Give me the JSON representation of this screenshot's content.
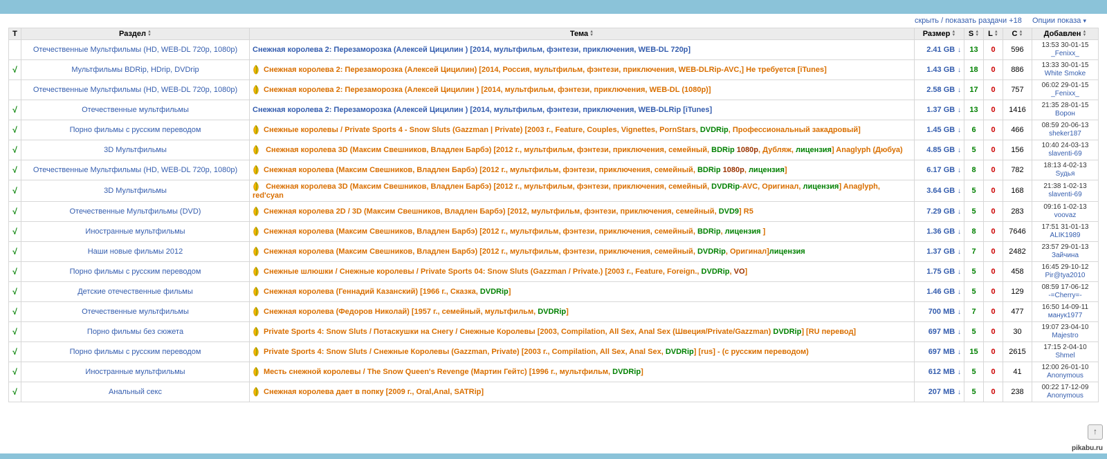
{
  "top_links": {
    "hide_show": "скрыть / показать раздачи +18",
    "display_options": "Опции показа"
  },
  "headers": {
    "t": "Т",
    "section": "Раздел",
    "topic": "Тема",
    "size": "Размер",
    "s": "S",
    "l": "L",
    "c": "C",
    "added": "Добавлен"
  },
  "col_widths": {
    "chk": 18,
    "cat": 330,
    "topic": 0,
    "size": 72,
    "s": 28,
    "l": 28,
    "c": 40,
    "added": 94
  },
  "rows": [
    {
      "chk": "",
      "cat": "Отечественные Мультфильмы (HD, WEB-DL 720p, 1080p)",
      "topic_html": "<a class='t-blue'>Снежная королева 2: Перезаморозка (Алексей Цицилин ) [2014, мультфильм, фэнтези, приключения, WEB-DL 720p]</a>",
      "size": "2.41 GB",
      "s": 13,
      "l": 0,
      "c": 596,
      "date": "13:53 30-01-15",
      "user": "_Fenixx_"
    },
    {
      "chk": "√",
      "cat": "Мультфильмы BDRip, HDrip, DVDrip",
      "topic_html": "<span class='seed-icon' data-name='seed-icon' data-interactable='false'></span><a class='t-orange'>Снежная королева 2: Перезаморозка (Алексей Цицилин) [2014, Россия, мультфильм, фэнтези, приключения, WEB-DLRip-AVC,] Не требуется [iTunes]</a>",
      "size": "1.43 GB",
      "s": 18,
      "l": 0,
      "c": 886,
      "date": "13:33 30-01-15",
      "user": "White Smoke"
    },
    {
      "chk": "",
      "cat": "Отечественные Мультфильмы (HD, WEB-DL 720p, 1080p)",
      "topic_html": "<span class='seed-icon' data-name='seed-icon' data-interactable='false'></span><a class='t-orange'>Снежная королева 2: Перезаморозка (Алексей Цицилин ) [2014, мультфильм, фэнтези, приключения, WEB-DL (1080p)]</a>",
      "size": "2.58 GB",
      "s": 17,
      "l": 0,
      "c": 757,
      "date": "06:02 29-01-15",
      "user": "_Fenixx_"
    },
    {
      "chk": "√",
      "cat": "Отечественные мультфильмы",
      "topic_html": "<a class='t-blue'>Снежная королева 2: Перезаморозка (Алексей Цицилин ) [2014, мультфильм, фэнтези, приключения, WEB-DLRip [iTunes]</a>",
      "size": "1.37 GB",
      "s": 13,
      "l": 0,
      "c": 1416,
      "date": "21:35 28-01-15",
      "user": "Ворон"
    },
    {
      "chk": "√",
      "cat": "Порно фильмы с русским переводом",
      "topic_html": "<span class='seed-icon' data-name='seed-icon' data-interactable='false'></span><a class='t-orange'>Снежные королевы / Private Sports 4 - Snow Sluts (Gazzman | Private) [2003 г., Feature, Couples, Vignettes, PornStars, <span class='t-green'>DVDRip</span>, Профессиональный закадровый]</a>",
      "size": "1.45 GB",
      "s": 6,
      "l": 0,
      "c": 466,
      "date": "08:59 20-06-13",
      "user": "sheker187"
    },
    {
      "chk": "√",
      "cat": "3D Мультфильмы",
      "topic_html": "<span class='seed-icon' data-name='seed-icon' data-interactable='false'></span>&nbsp;<a class='t-orange'>Снежная королева 3D (Максим Свешников, Владлен Барбэ) [2012 г., мультфильм, фэнтези, приключения, семейный, <span class='t-green'>BDRip</span> <span class='t-darkred'>1080p</span>, Дубляж, <span class='t-green'>лицензия</span>] Anaglyph (Дюбуа)</a>",
      "size": "4.85 GB",
      "s": 5,
      "l": 0,
      "c": 156,
      "date": "10:40 24-03-13",
      "user": "slaventi-69"
    },
    {
      "chk": "√",
      "cat": "Отечественные Мультфильмы (HD, WEB-DL 720p, 1080p)",
      "topic_html": "<span class='seed-icon' data-name='seed-icon' data-interactable='false'></span><a class='t-orange'>Снежная королева (Максим Свешников, Владлен Барбэ) [2012 г., мультфильм, фэнтези, приключения, семейный, <span class='t-green'>BDRip</span> <span class='t-darkred'>1080p</span>, <span class='t-green'>лицензия</span>]</a>",
      "size": "6.17 GB",
      "s": 8,
      "l": 0,
      "c": 782,
      "date": "18:13 4-02-13",
      "user": "Sудья"
    },
    {
      "chk": "√",
      "cat": "3D Мультфильмы",
      "topic_html": "<span class='seed-icon' data-name='seed-icon' data-interactable='false'></span>&nbsp;<a class='t-orange'>Снежная королева 3D (Максим Свешников, Владлен Барбэ) [2012 г., мультфильм, фэнтези, приключения, семейный, <span class='t-green'>DVDRip</span>-AVC, Оригинал, <span class='t-green'>лицензия</span>] Anaglyph, red'cyan</a>",
      "size": "3.64 GB",
      "s": 5,
      "l": 0,
      "c": 168,
      "date": "21:38 1-02-13",
      "user": "slaventi-69"
    },
    {
      "chk": "√",
      "cat": "Отечественные Мультфильмы (DVD)",
      "topic_html": "<span class='seed-icon' data-name='seed-icon' data-interactable='false'></span><a class='t-orange'>Снежная королева 2D / 3D (Максим Свешников, Владлен Барбэ) [2012, мультфильм, фэнтези, приключения, семейный, <span class='t-green'>DVD9</span>] R5</a>",
      "size": "7.29 GB",
      "s": 5,
      "l": 0,
      "c": 283,
      "date": "09:16 1-02-13",
      "user": "voovaz"
    },
    {
      "chk": "√",
      "cat": "Иностранные мультфильмы",
      "topic_html": "<span class='seed-icon' data-name='seed-icon' data-interactable='false'></span><a class='t-orange'>Снежная королева (Максим Свешников, Владлен Барбэ) [2012 г., мультфильм, фэнтези, приключения, семейный, <span class='t-green'>BDRip</span>, <span class='t-green'>лицензия</span> ]</a>",
      "size": "1.36 GB",
      "s": 8,
      "l": 0,
      "c": 7646,
      "date": "17:51 31-01-13",
      "user": "ALIK1989"
    },
    {
      "chk": "√",
      "cat": "Наши новые фильмы 2012",
      "topic_html": "<span class='seed-icon' data-name='seed-icon' data-interactable='false'></span><a class='t-orange'>Снежная королева (Максим Свешников, Владлен Барбэ) [2012 г., мультфильм, фэнтези, приключения, семейный, <span class='t-green'>DVDRip</span>, Оригинал]<span class='t-green'>лицензия</span></a>",
      "size": "1.37 GB",
      "s": 7,
      "l": 0,
      "c": 2482,
      "date": "23:57 29-01-13",
      "user": "Зайчина"
    },
    {
      "chk": "√",
      "cat": "Порно фильмы с русским переводом",
      "topic_html": "<span class='seed-icon' data-name='seed-icon' data-interactable='false'></span><a class='t-orange'>Снежные шлюшки / Снежные королевы / Private Sports 04: Snow Sluts (Gazzman / Private.) [2003 г., Feature, Foreign., <span class='t-green'>DVDRip</span>, <span class='t-darkred'>VO</span>]</a>",
      "size": "1.75 GB",
      "s": 5,
      "l": 0,
      "c": 458,
      "date": "16:45 29-10-12",
      "user": "Pir@tya2010"
    },
    {
      "chk": "√",
      "cat": "Детские отечественные фильмы",
      "topic_html": "<span class='seed-icon' data-name='seed-icon' data-interactable='false'></span><a class='t-orange'>Снежная королева (Геннадий Казанский) [1966 г., Сказка, <span class='t-green'>DVDRip</span>]</a>",
      "size": "1.46 GB",
      "s": 5,
      "l": 0,
      "c": 129,
      "date": "08:59 17-06-12",
      "user": "-=Cherry=-"
    },
    {
      "chk": "√",
      "cat": "Отечественные мультфильмы",
      "topic_html": "<span class='seed-icon' data-name='seed-icon' data-interactable='false'></span><a class='t-orange'>Снежная королева (Федоров Николай) [1957 г., семейный, мультфильм, <span class='t-green'>DVDRip</span>]</a>",
      "size": "700 MB",
      "s": 7,
      "l": 0,
      "c": 477,
      "date": "16:50 14-09-11",
      "user": "манук1977"
    },
    {
      "chk": "√",
      "cat": "Порно фильмы без сюжета",
      "topic_html": "<span class='seed-icon' data-name='seed-icon' data-interactable='false'></span><a class='t-orange'>Private Sports 4: Snow Sluts / Потаскушки на Снегу / Снежные Королевы [2003, Compilation, All Sex, Anal Sex (Швеция/Private/Gazzman) <span class='t-green'>DVDRip</span>] [RU перевод]</a>",
      "size": "697 MB",
      "s": 5,
      "l": 0,
      "c": 30,
      "date": "19:07 23-04-10",
      "user": "Majestro"
    },
    {
      "chk": "√",
      "cat": "Порно фильмы с русским переводом",
      "topic_html": "<span class='seed-icon' data-name='seed-icon' data-interactable='false'></span><a class='t-orange'>Private Sports 4: Snow Sluts / Снежные Королевы (Gazzman, Private) [2003 г., Compilation, All Sex, Anal Sex, <span class='t-green'>DVDRip</span>] [rus] - (с русским переводом)</a>",
      "size": "697 MB",
      "s": 15,
      "l": 0,
      "c": 2615,
      "date": "17:15 2-04-10",
      "user": "Shmel"
    },
    {
      "chk": "√",
      "cat": "Иностранные мультфильмы",
      "topic_html": "<span class='seed-icon' data-name='seed-icon' data-interactable='false'></span><a class='t-orange'>Месть снежной королевы / The Snow Queen's Revenge (Мартин Гейтс) [1996 г., мультфильм, <span class='t-green'>DVDRip</span>]</a>",
      "size": "612 MB",
      "s": 5,
      "l": 0,
      "c": 41,
      "date": "12:00 26-01-10",
      "user": "Anonymous"
    },
    {
      "chk": "√",
      "cat": "Анальный секс",
      "topic_html": "<span class='seed-icon' data-name='seed-icon' data-interactable='false'></span><a class='t-orange'>Снежная королева дает в попку [2009 г., Oral,Anal, SATRip]</a>",
      "size": "207 MB",
      "s": 5,
      "l": 0,
      "c": 238,
      "date": "00:22 17-12-09",
      "user": "Anonymous"
    }
  ],
  "footer": {
    "pikabu": "pikabu.ru"
  }
}
